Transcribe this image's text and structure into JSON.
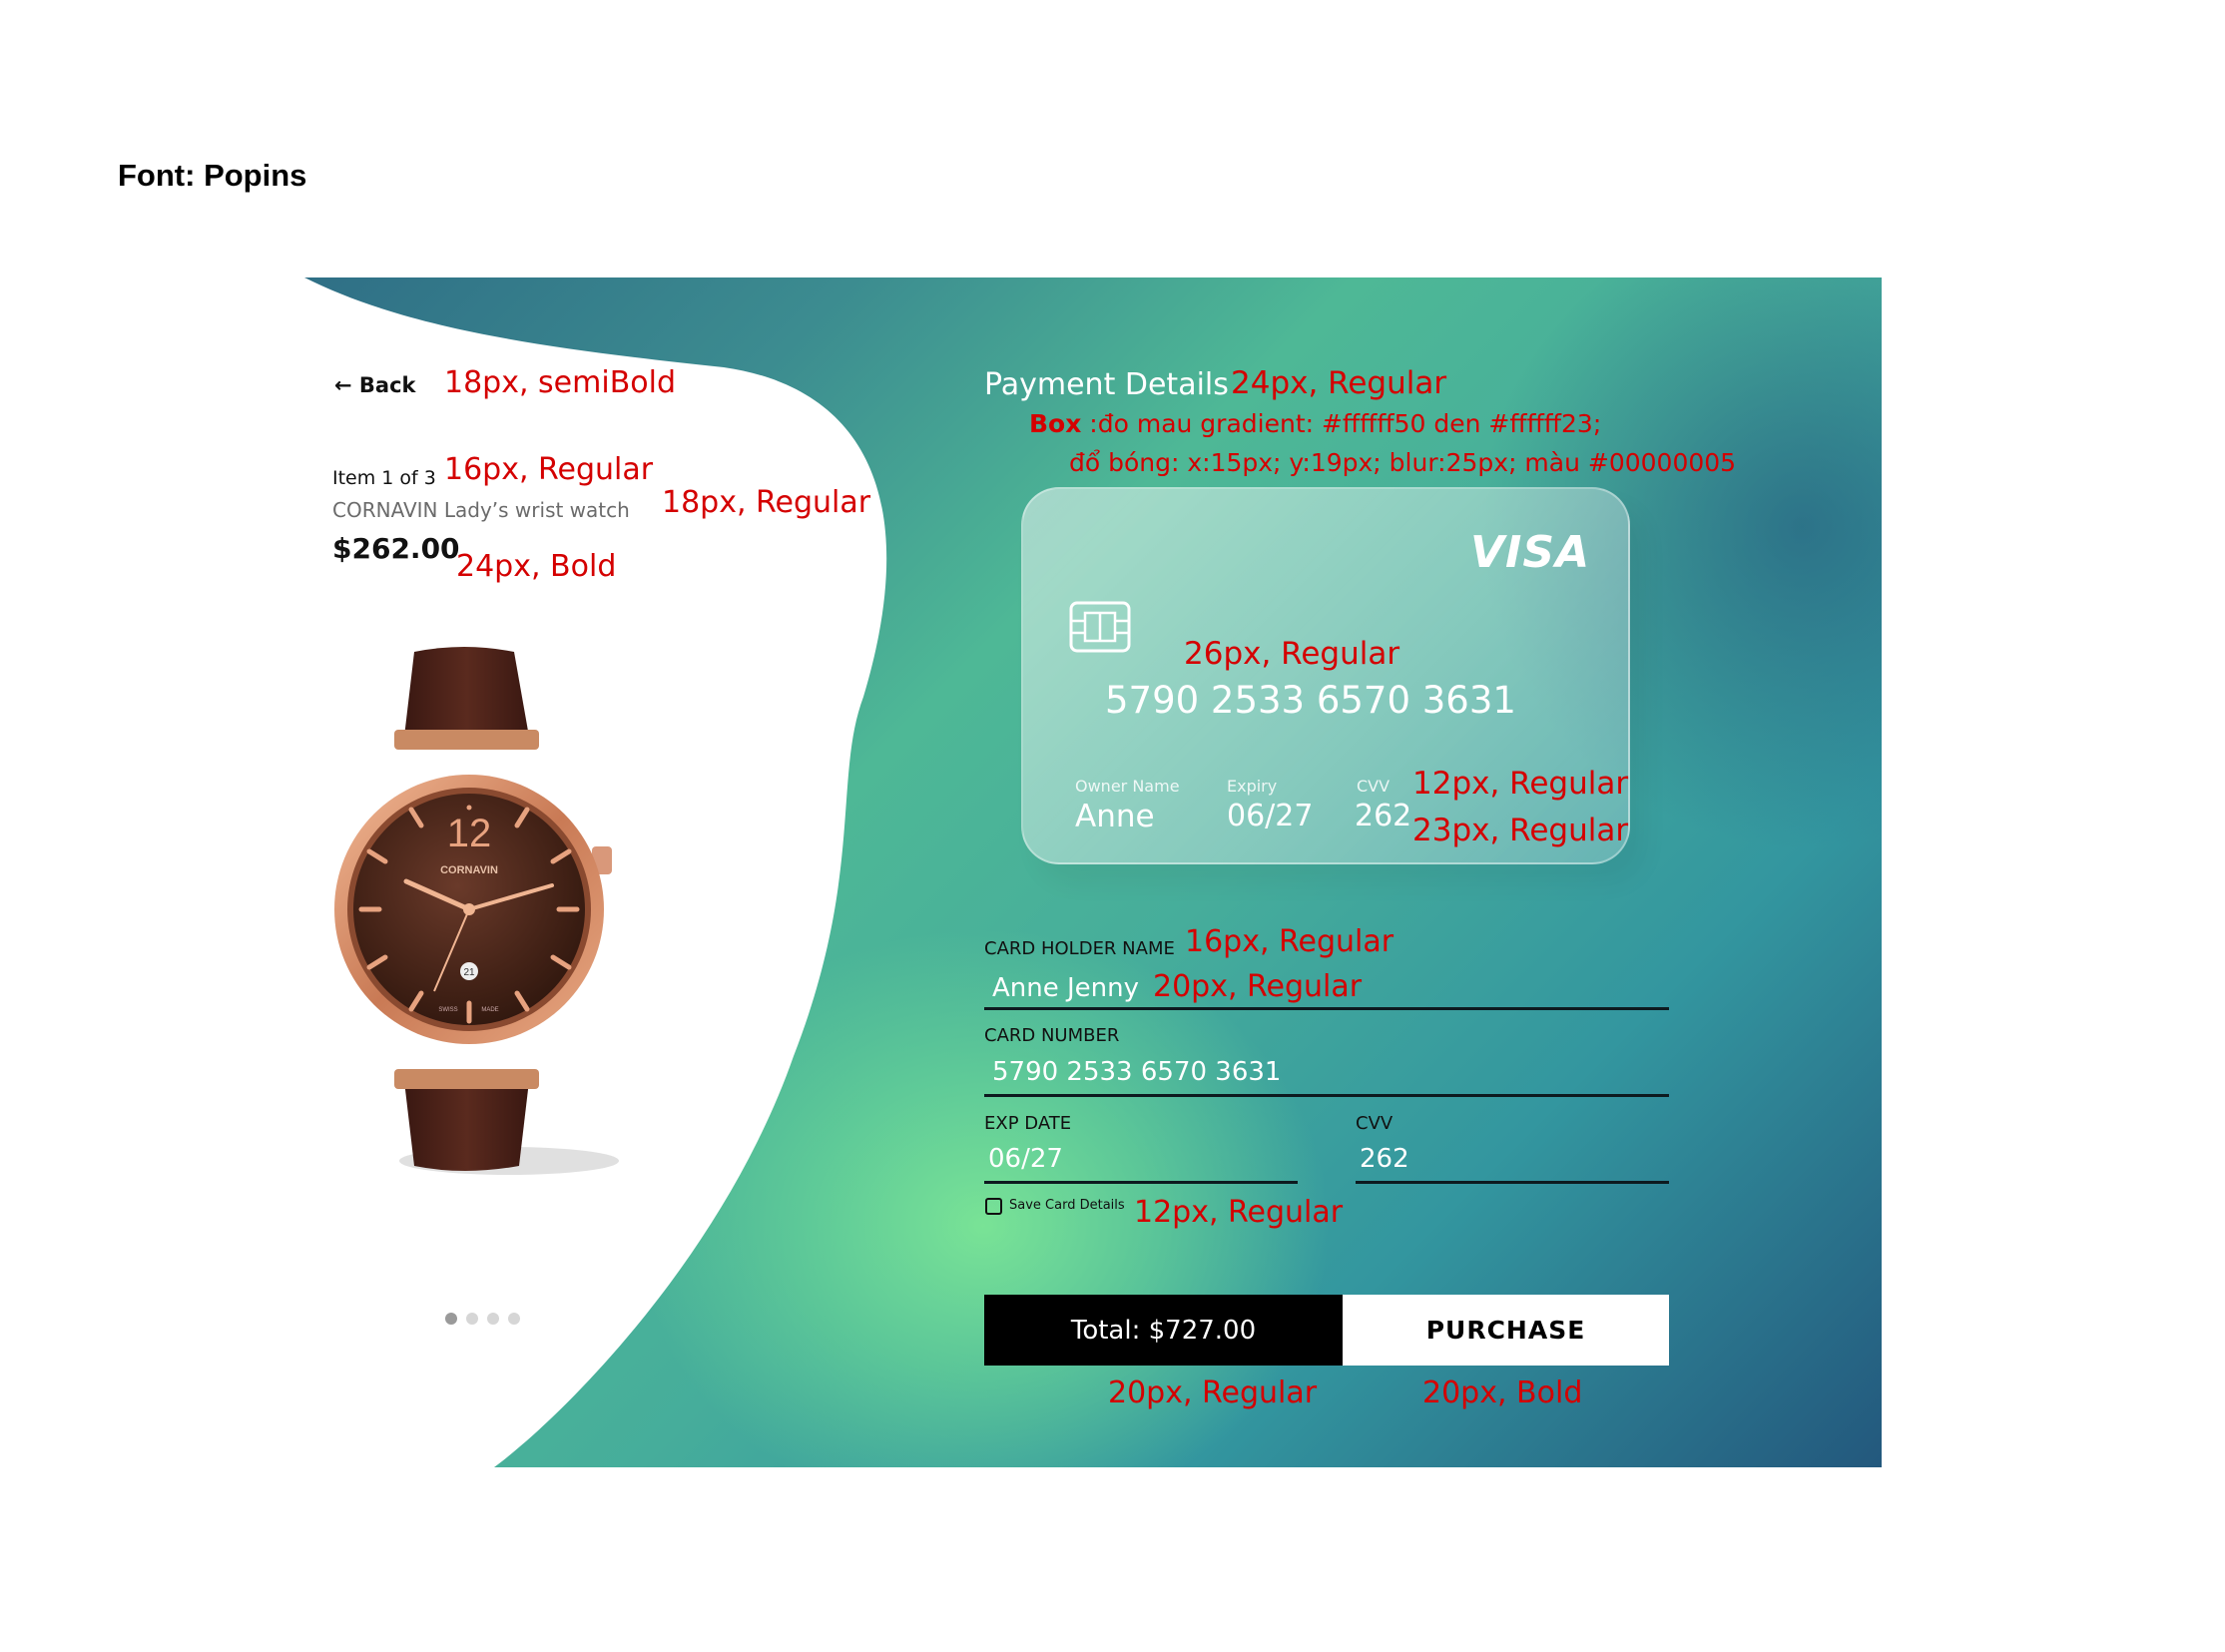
{
  "doc": {
    "font_note": "Font: Popins"
  },
  "left": {
    "back_label": "Back",
    "item_counter": "Item 1 of 3",
    "product_name": "CORNAVIN Lady’s wrist watch",
    "price": "$262.00",
    "watch": {
      "brand": "CORNAVIN",
      "dial_numeral": "12",
      "date": "21",
      "footer_left": "SWISS",
      "footer_right": "MADE"
    },
    "carousel": {
      "count": 4,
      "active_index": 0
    }
  },
  "payment": {
    "title": "Payment Details",
    "card": {
      "brand": "VISA",
      "number": "5790 2533 6570 3631",
      "owner_label": "Owner Name",
      "owner_value": "Anne",
      "expiry_label": "Expiry",
      "expiry_value": "06/27",
      "cvv_label": "CVV",
      "cvv_value": "262"
    },
    "form": {
      "holder_label": "CARD HOLDER NAME",
      "holder_value": "Anne Jenny",
      "number_label": "CARD NUMBER",
      "number_value": "5790 2533 6570 3631",
      "exp_label": "EXP DATE",
      "exp_value": "06/27",
      "cvv_label": "CVV",
      "cvv_value": "262",
      "save_label": "Save Card Details"
    },
    "total_label": "Total: $727.00",
    "purchase_label": "PURCHASE"
  },
  "annotations": {
    "back": "18px, semiBold",
    "item": "16px, Regular",
    "name": "18px, Regular",
    "price": "24px, Bold",
    "title": "24px, Regular",
    "box_bold": "Box",
    "box_line1": " :đo mau gradient: #ffffff50 den #ffffff23;",
    "box_line2": "đổ bóng: x:15px; y:19px; blur:25px; màu #00000005",
    "card_number": "26px, Regular",
    "card_labels": "12px, Regular",
    "card_values": "23px, Regular",
    "holder_label": "16px, Regular",
    "holder_value": "20px, Regular",
    "save": "12px, Regular",
    "total": "20px, Regular",
    "purchase": "20px, Bold"
  },
  "colors": {
    "accent_annotation": "#d40000",
    "gradient_dark": "#23587d",
    "gradient_green": "#7ce696"
  }
}
